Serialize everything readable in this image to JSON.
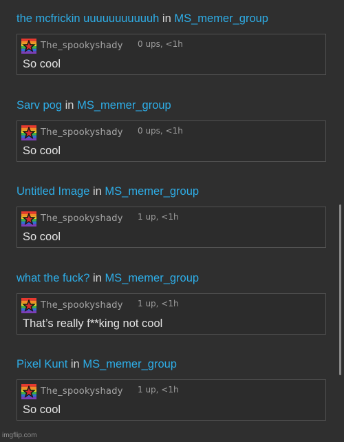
{
  "entries": [
    {
      "post_title": "the mcfrickin uuuuuuuuuuuh",
      "in_label": "in",
      "group": "MS_memer_group",
      "comment": {
        "username": "The_spookyshady",
        "meta": "0 ups, <1h",
        "text": "So cool"
      }
    },
    {
      "post_title": "Sarv pog",
      "in_label": "in",
      "group": "MS_memer_group",
      "comment": {
        "username": "The_spookyshady",
        "meta": "0 ups, <1h",
        "text": "So cool"
      }
    },
    {
      "post_title": "Untitled Image",
      "in_label": "in",
      "group": "MS_memer_group",
      "comment": {
        "username": "The_spookyshady",
        "meta": "1 up, <1h",
        "text": "So cool"
      }
    },
    {
      "post_title": "what the fuck?",
      "in_label": "in",
      "group": "MS_memer_group",
      "comment": {
        "username": "The_spookyshady",
        "meta": "1 up, <1h",
        "text": "That’s really f**king not cool"
      }
    },
    {
      "post_title": "Pixel Kunt",
      "in_label": "in",
      "group": "MS_memer_group",
      "comment": {
        "username": "The_spookyshady",
        "meta": "1 up, <1h",
        "text": "So cool"
      }
    }
  ],
  "watermark": "imgflip.com",
  "colors": {
    "background": "#2f2f2f",
    "link": "#2eaee8",
    "text": "#e4e4e4",
    "muted": "#a6a6a6",
    "border": "#525252"
  },
  "icons": {
    "avatar": "rainbow-star-avatar-icon"
  }
}
